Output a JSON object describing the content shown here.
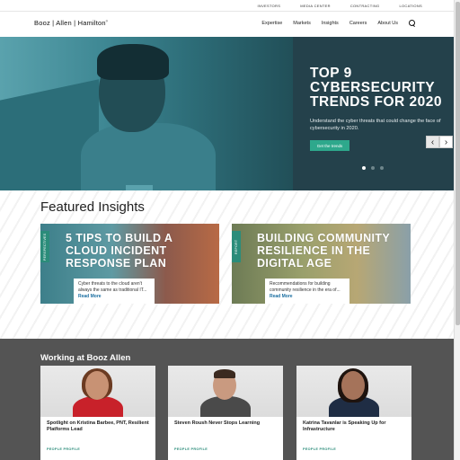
{
  "utility_nav": [
    "INVESTORS",
    "MEDIA CENTER",
    "CONTRACTING",
    "LOCATIONS"
  ],
  "logo": {
    "text": "Booz | Allen | Hamilton",
    "mark": "®"
  },
  "nav": [
    "Expertise",
    "Markets",
    "Insights",
    "Careers",
    "About Us"
  ],
  "hero": {
    "title": "TOP 9 CYBERSECURITY TRENDS FOR 2020",
    "subtitle": "Understand the cyber threats that could change the face of cybersecurity in 2020.",
    "button": "Get the trends",
    "prev": "‹",
    "next": "›",
    "slide_count": 3,
    "active_slide": 1
  },
  "featured": {
    "title": "Featured Insights",
    "cards": [
      {
        "tag": "PERSPECTIVES",
        "title": "5 TIPS TO BUILD A CLOUD INCIDENT RESPONSE PLAN",
        "desc": "Cyber threats to the cloud aren't always the same as traditional IT...",
        "more": "Read More"
      },
      {
        "tag": "REPORT",
        "title": "BUILDING COMMUNITY RESILIENCE IN THE DIGITAL AGE",
        "desc": "Recommendations for building community resilience in the era of...",
        "more": "Read More"
      }
    ]
  },
  "working": {
    "title": "Working at Booz Allen",
    "profiles": [
      {
        "name": "Spotlight on Kristina Barbee, PNT, Resilient Platforms Lead",
        "tag": "PEOPLE PROFILE"
      },
      {
        "name": "Steven Roush Never Stops Learning",
        "tag": "PEOPLE PROFILE"
      },
      {
        "name": "Katrina Tavanlar is Speaking Up for Infrastructure",
        "tag": "PEOPLE PROFILE"
      }
    ]
  },
  "colors": {
    "hero_panel": "#24414b",
    "accent_green": "#2ea88c",
    "link_blue": "#1a6ea0",
    "working_bg": "#545454"
  }
}
